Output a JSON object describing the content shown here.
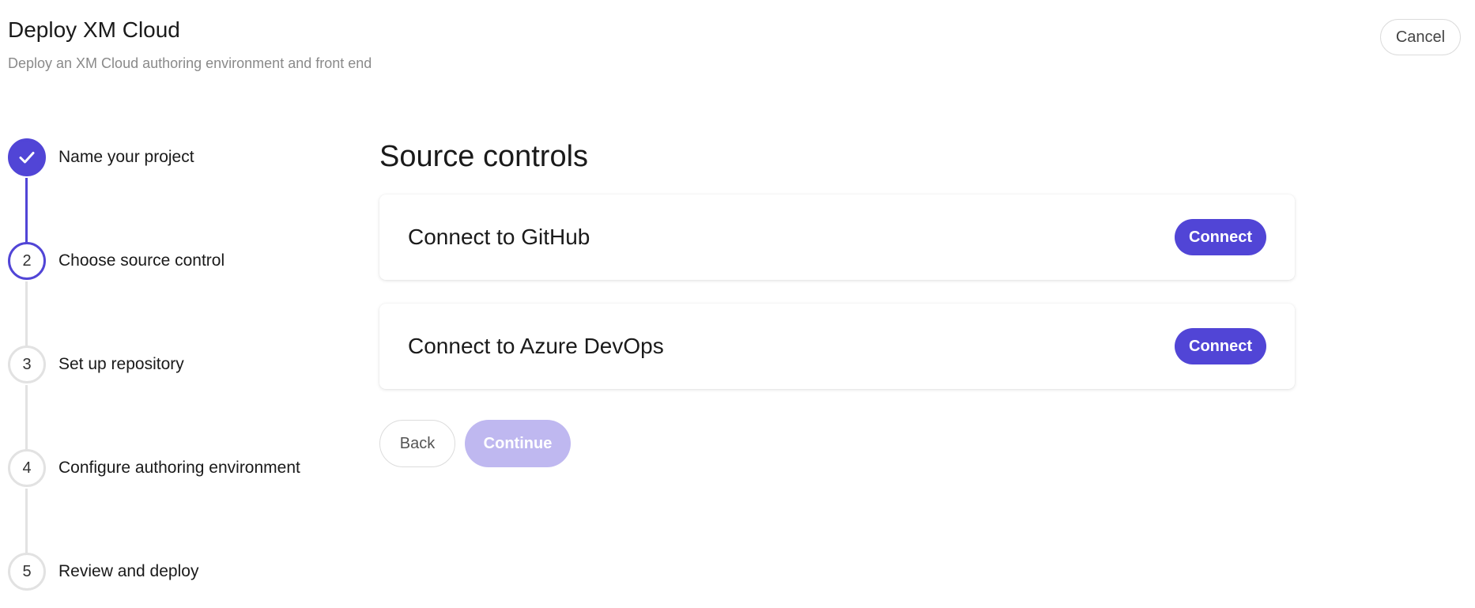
{
  "header": {
    "title": "Deploy XM Cloud",
    "subtitle": "Deploy an XM Cloud authoring environment and front end",
    "cancel_label": "Cancel"
  },
  "stepper": {
    "steps": [
      {
        "number": "1",
        "label": "Name your project",
        "status": "completed",
        "icon": "check-icon"
      },
      {
        "number": "2",
        "label": "Choose source control",
        "status": "active"
      },
      {
        "number": "3",
        "label": "Set up repository",
        "status": "pending"
      },
      {
        "number": "4",
        "label": "Configure authoring environment",
        "status": "pending"
      },
      {
        "number": "5",
        "label": "Review and deploy",
        "status": "pending"
      }
    ]
  },
  "main": {
    "section_title": "Source controls",
    "providers": [
      {
        "label": "Connect to GitHub",
        "button_label": "Connect"
      },
      {
        "label": "Connect to Azure DevOps",
        "button_label": "Connect"
      }
    ],
    "back_label": "Back",
    "continue_label": "Continue",
    "continue_disabled": true
  },
  "colors": {
    "accent": "#5145d6",
    "accent_disabled": "#bfb8f0",
    "step_inactive_border": "#e2e2e2",
    "subtitle_text": "#8a8a8a"
  }
}
